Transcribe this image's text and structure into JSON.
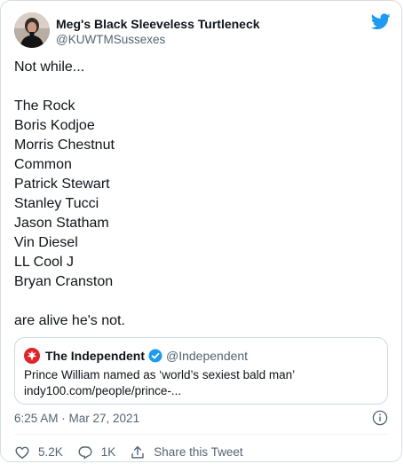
{
  "author": {
    "display_name": "Meg's Black Sleeveless Turtleneck",
    "handle": "@KUWTMSussexes"
  },
  "icons": {
    "logo": "twitter-bird-icon",
    "avatar": "profile-photo",
    "quote_logo": "the-independent-eagle-logo",
    "verified": "verified-badge-icon",
    "info": "info-icon",
    "like": "heart-icon",
    "reply": "speech-bubble-icon",
    "share": "share-upload-icon"
  },
  "tweet": {
    "lines": [
      "Not while...",
      "",
      "The Rock",
      "Boris Kodjoe",
      "Morris Chestnut",
      "Common",
      "Patrick Stewart",
      "Stanley Tucci",
      "Jason Statham",
      "Vin Diesel",
      "LL Cool J",
      "Bryan Cranston",
      "",
      "are alive he's not."
    ]
  },
  "quote": {
    "name": "The Independent",
    "handle": "@Independent",
    "text_line_1": "Prince William named as ‘world’s sexiest bald man’",
    "text_line_2": "indy100.com/people/prince-..."
  },
  "meta": {
    "timestamp": "6:25 AM · Mar 27, 2021"
  },
  "actions": {
    "likes": "5.2K",
    "replies": "1K",
    "share_label": "Share this Tweet"
  },
  "colors": {
    "twitter_blue": "#1d9bf0",
    "verified_blue": "#1d9bf0",
    "independent_red": "#e0242b",
    "text_primary": "#0f1419",
    "text_secondary": "#536471",
    "border": "#cfd9de"
  }
}
